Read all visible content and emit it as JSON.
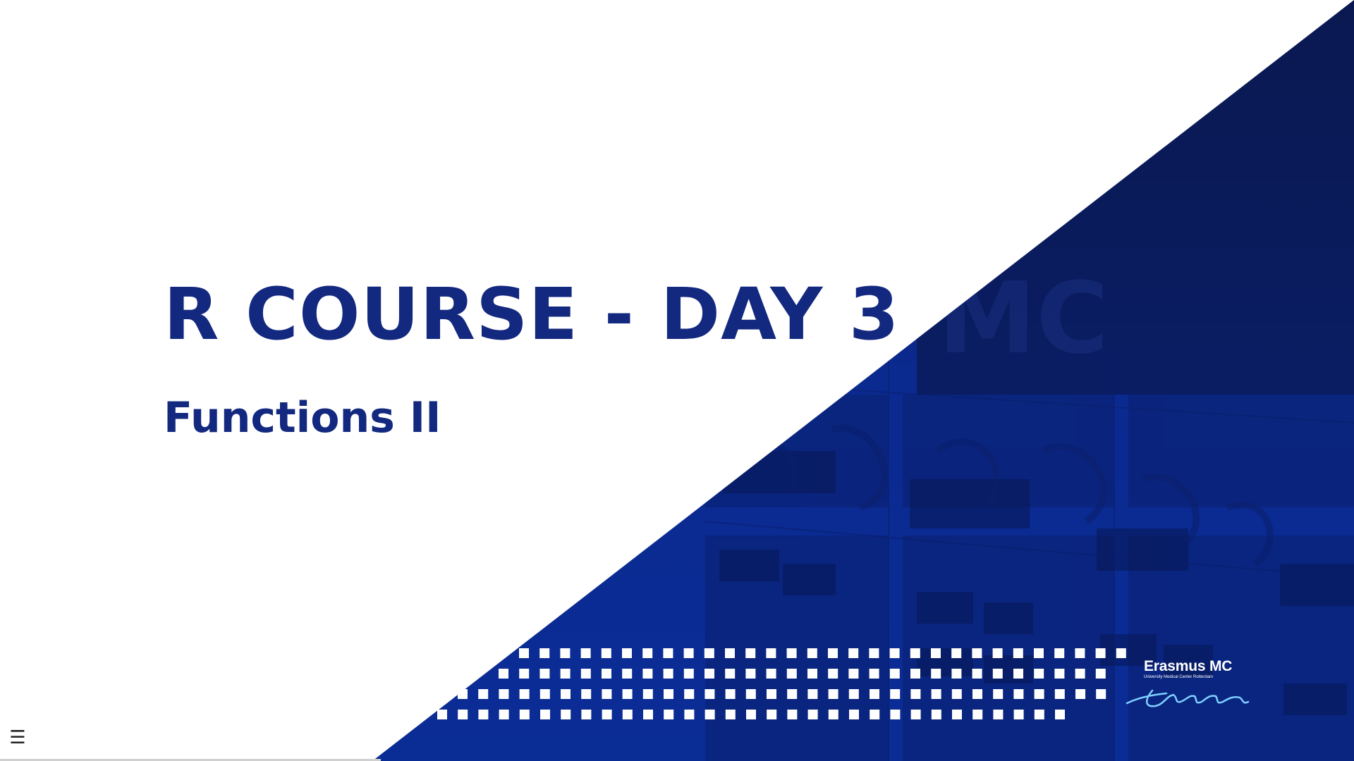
{
  "slide": {
    "title": "R COURSE - DAY 3",
    "subtitle": "Functions II"
  },
  "logo": {
    "name": "Erasmus MC",
    "tagline": "University Medical Center Rotterdam"
  },
  "controls": {
    "menu_glyph": "☰",
    "menu_icon": "hamburger-menu-icon"
  },
  "colors": {
    "title_text": "#13287f",
    "panel_light": "#0b2a90",
    "panel_dark": "#0b1a55",
    "dots": "#ffffff",
    "background": "#ffffff"
  }
}
